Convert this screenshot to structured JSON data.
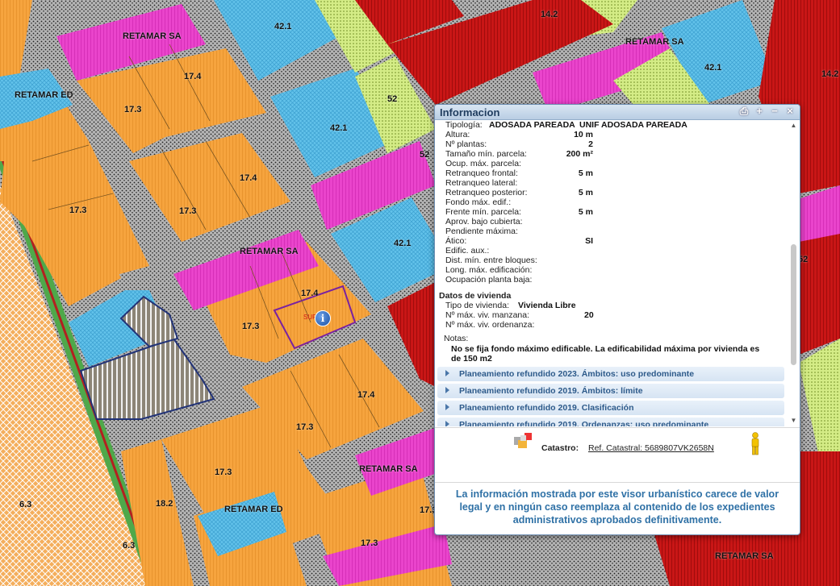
{
  "map": {
    "labels": [
      "42.1",
      "14.2",
      "RETAMAR SA",
      "RETAMAR SA",
      "14.2",
      "17.4",
      "42.1",
      "RETAMAR ED",
      "17.3",
      "52",
      "42.1",
      "17.4",
      "17.3",
      "17.3",
      "RETAMAR SA",
      "42.1",
      "17.4",
      "17.3",
      "17.4",
      "17.3",
      "17.3",
      "RETAMAR SA",
      "17.3",
      "6.3",
      "18.2",
      "RETAMAR ED",
      "17.3",
      "6.3",
      "RETAMAR SA",
      "52",
      "52"
    ],
    "info_marker": "i",
    "sur_label": "SUR",
    "colors": {
      "orange": "#f5a23c",
      "magenta": "#e83cc8",
      "blue": "#5bbde6",
      "red": "#c81414",
      "lime": "#cde87a",
      "road": "#9c9c9c"
    }
  },
  "window": {
    "title": "Informacion",
    "controls": {
      "print": "⎙",
      "maximize": "+",
      "minimize": "−",
      "close": "×"
    },
    "tipologia": {
      "label": "Tipología:",
      "value1": "ADOSADA PAREADA",
      "value2": "UNIF ADOSADA PAREADA"
    },
    "params": [
      {
        "label": "Altura:",
        "value": "10 m"
      },
      {
        "label": "Nº plantas:",
        "value": "2"
      },
      {
        "label": "Tamaño mín. parcela:",
        "value": "200 m²"
      },
      {
        "label": "Ocup. máx. parcela:",
        "value": ""
      },
      {
        "label": "Retranqueo frontal:",
        "value": "5 m"
      },
      {
        "label": "Retranqueo lateral:",
        "value": ""
      },
      {
        "label": "Retranqueo posterior:",
        "value": "5 m"
      },
      {
        "label": "Fondo máx. edif.:",
        "value": ""
      },
      {
        "label": "Frente mín. parcela:",
        "value": "5 m"
      },
      {
        "label": "Aprov. bajo cubierta:",
        "value": ""
      },
      {
        "label": "Pendiente máxima:",
        "value": ""
      },
      {
        "label": "Ático:",
        "value": "SI"
      },
      {
        "label": "Edific. aux.:",
        "value": ""
      },
      {
        "label": "Dist. mín. entre bloques:",
        "value": ""
      },
      {
        "label": "Long. máx. edificación:",
        "value": ""
      },
      {
        "label": "Ocupación planta baja:",
        "value": ""
      }
    ],
    "vivienda": {
      "heading": "Datos de vivienda",
      "tipo_label": "Tipo de vivienda:",
      "tipo_value": "Vivienda Libre",
      "manzana_label": "Nº máx. viv. manzana:",
      "manzana_value": "20",
      "ordenanza_label": "Nº máx. viv. ordenanza:",
      "ordenanza_value": ""
    },
    "notas": {
      "label": "Notas:",
      "text1": "No se fija fondo máximo edificable. La edificabilidad máxima por vivienda es",
      "text2": "de 150 m2"
    },
    "accordion": [
      "Planeamiento refundido 2023. Ámbitos: uso predominante",
      "Planeamiento refundido 2019. Ámbitos: límite",
      "Planeamiento refundido 2019. Clasificación",
      "Planeamiento refundido 2019. Ordenanzas: uso predominante"
    ],
    "catastro": {
      "label": "Catastro:",
      "ref": "Ref. Catastral: 5689807VK2658N"
    },
    "disclaimer": [
      "La información mostrada por este visor urbanístico carece de valor",
      "legal y en ningún caso reemplaza al contenido de los expedientes",
      "administrativos aprobados definitivamente."
    ]
  }
}
